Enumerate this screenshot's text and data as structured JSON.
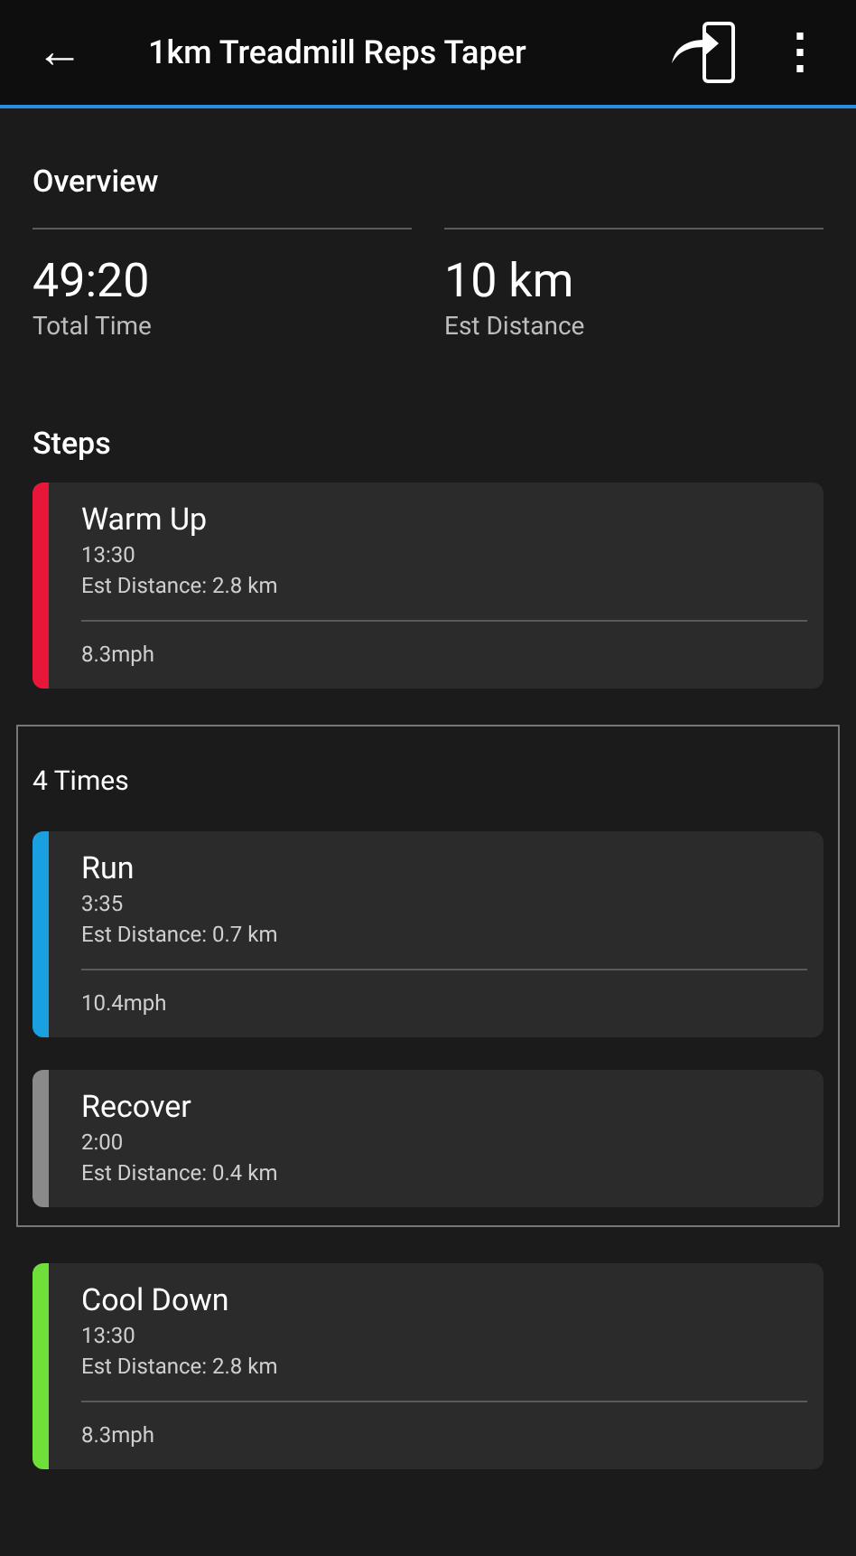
{
  "header": {
    "back": "←",
    "title": "1km Treadmill Reps Taper",
    "menu": "⋮"
  },
  "overview": {
    "title": "Overview",
    "stats": [
      {
        "value": "49:20",
        "label": "Total Time"
      },
      {
        "value": "10 km",
        "label": "Est Distance"
      }
    ]
  },
  "steps_title": "Steps",
  "steps": [
    {
      "kind": "step",
      "name": "Warm Up",
      "duration": "13:30",
      "distance": "Est Distance: 2.8 km",
      "target": "8.3mph",
      "color": "#e8173a"
    },
    {
      "kind": "repeat",
      "label": "4 Times",
      "children": [
        {
          "kind": "step",
          "name": "Run",
          "duration": "3:35",
          "distance": "Est Distance: 0.7 km",
          "target": "10.4mph",
          "color": "#1a9fe0"
        },
        {
          "kind": "step",
          "name": "Recover",
          "duration": "2:00",
          "distance": "Est Distance: 0.4 km",
          "color": "#8a8a8a"
        }
      ]
    },
    {
      "kind": "step",
      "name": "Cool Down",
      "duration": "13:30",
      "distance": "Est Distance: 2.8 km",
      "target": "8.3mph",
      "color": "#6fe03a"
    }
  ]
}
